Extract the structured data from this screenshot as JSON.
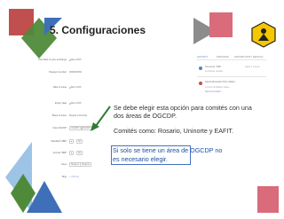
{
  "slide": {
    "title": "5. Configuraciones",
    "logo_description": "Yellow hexagonal badge logo with a figure",
    "callout": {
      "lines": [
        "Se debe elegir esta opción para comités con una",
        "dos áreas de OGCDP."
      ],
      "example_line": "Comités como: Rosario, Uninorte y EAFIT.",
      "highlight_lines": [
        "Si solo se tiene un área de OGCDP no",
        "es necesario elegir."
      ]
    },
    "colors": {
      "red_square": "#c0504d",
      "pink_square": "#d96b7a",
      "green_diamond": "#4f8a3a",
      "blue_triangle": "#3e6fb8",
      "light_blue_triangle": "#9dc3e6",
      "gray_triangle": "#8c8c8c",
      "highlight_border": "#4472c4",
      "logo_yellow": "#f6c700"
    }
  },
  "screenshot": {
    "form_fields": [
      {
        "label": "First Date of your exchange",
        "value": "May 2015",
        "type": "date"
      },
      {
        "label": "Passport number",
        "value": "00000000W",
        "type": "text"
      },
      {
        "label": "Date of issue",
        "value": "May 2015",
        "type": "date"
      },
      {
        "label": "Expiry date",
        "value": "May 2015",
        "type": "date"
      },
      {
        "label": "Place of issue",
        "value": "Bogotá Colombia",
        "type": "text"
      },
      {
        "label": "Area OGCDP",
        "chips": [
          "OGCDP 1",
          "OGCDP 2"
        ],
        "type": "chips"
      },
      {
        "label": "Standard 'SBR'",
        "chips": [
          "●",
          "No"
        ],
        "type": "chips"
      },
      {
        "label": "Format 'SBR'",
        "chips": [
          "●",
          "No"
        ],
        "type": "chips"
      },
      {
        "label": "Fees",
        "chips": [
          "Ninguno",
          "Ninguno"
        ],
        "type": "chips"
      },
      {
        "label": "Tags",
        "value": "+ Add tag",
        "type": "link"
      }
    ],
    "panel": {
      "tabs": [
        "ACTIVITY",
        "PROCESS",
        "OPPORTUNITY DETAILS"
      ],
      "entries": [
        {
          "name": "Someone, XMF",
          "action": "exchange update",
          "time": "Hace 3 meses"
        },
        {
          "name": "David Alexander Pinto Valdes",
          "action": "moved candidate status",
          "detail": "Recommended"
        }
      ]
    }
  }
}
